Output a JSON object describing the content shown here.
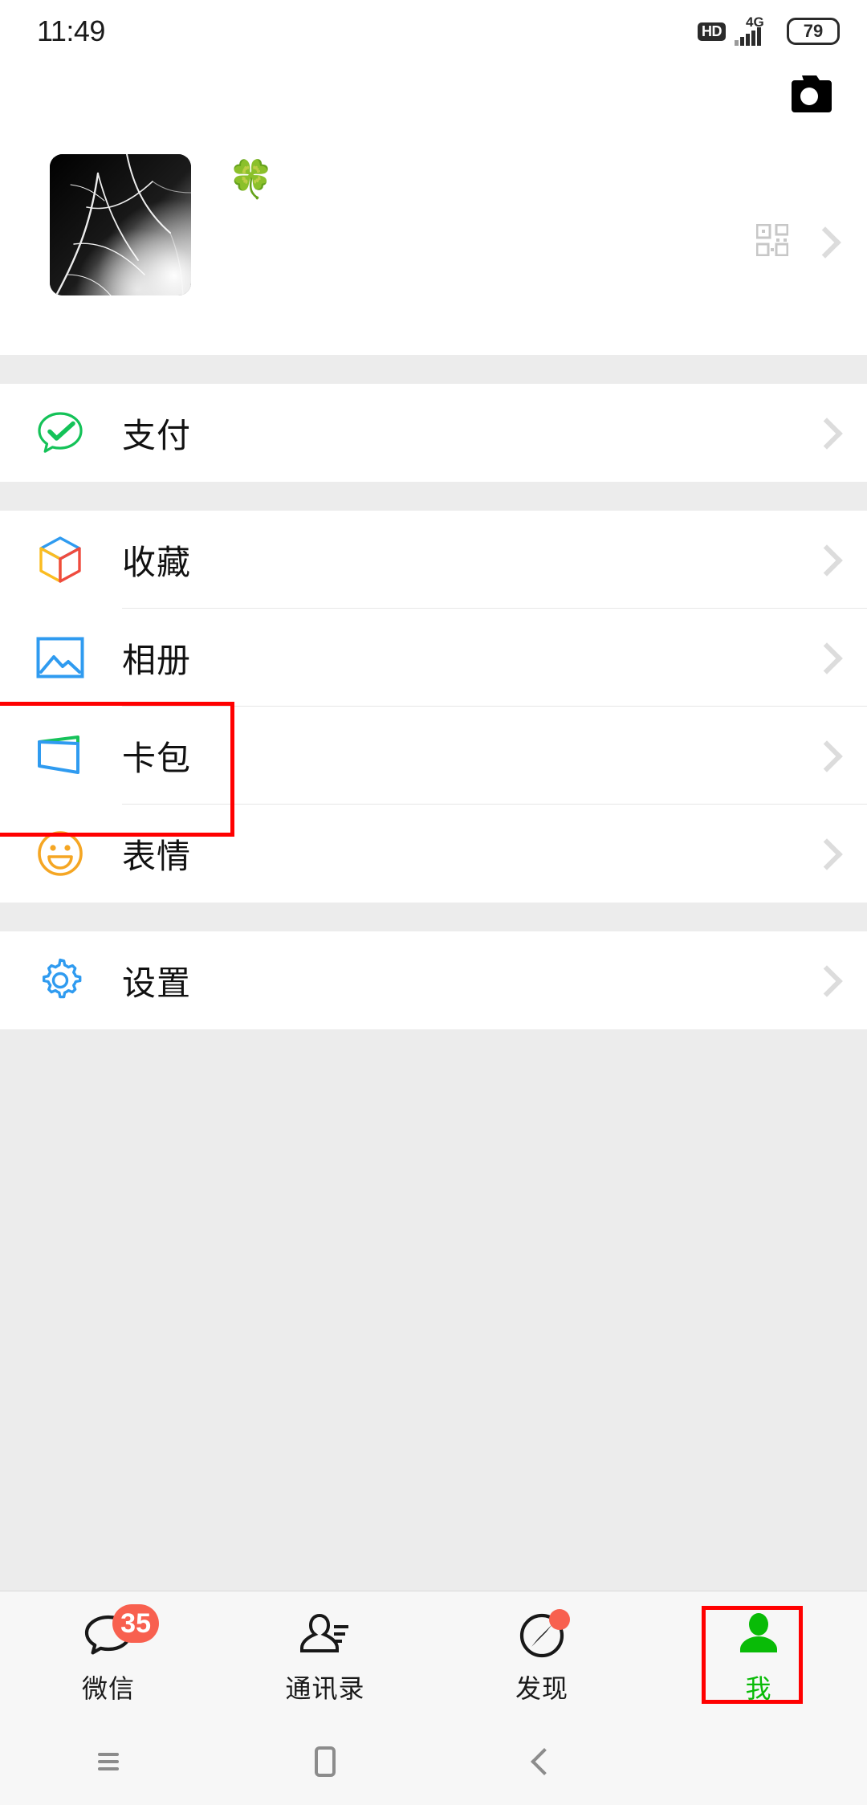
{
  "status_bar": {
    "time": "11:49",
    "hd_label": "HD",
    "network_label": "4G",
    "battery_level": "79"
  },
  "header": {
    "camera_icon": "camera-icon"
  },
  "profile": {
    "nickname": "🍀",
    "avatar_alt": "dark tree branches photo",
    "qr_icon": "qr-code-icon",
    "chevron": "chevron-right-icon"
  },
  "sections": [
    {
      "rows": [
        {
          "label": "支付",
          "icon": "wechat-pay-icon"
        }
      ]
    },
    {
      "rows": [
        {
          "label": "收藏",
          "icon": "favorites-cube-icon"
        },
        {
          "label": "相册",
          "icon": "album-photo-icon"
        },
        {
          "label": "卡包",
          "icon": "cards-wallet-icon"
        },
        {
          "label": "表情",
          "icon": "sticker-smiley-icon"
        }
      ]
    },
    {
      "rows": [
        {
          "label": "设置",
          "icon": "settings-gear-icon"
        }
      ]
    }
  ],
  "tabbar": {
    "items": [
      {
        "label": "微信",
        "icon": "chat-bubble-icon",
        "badge": "35",
        "active": false
      },
      {
        "label": "通讯录",
        "icon": "contacts-icon",
        "badge": "",
        "active": false
      },
      {
        "label": "发现",
        "icon": "compass-icon",
        "badge": "dot",
        "active": false
      },
      {
        "label": "我",
        "icon": "person-icon",
        "badge": "",
        "active": true
      }
    ]
  },
  "navbar": {
    "recents": "recents-icon",
    "home": "home-icon",
    "back": "back-icon"
  },
  "colors": {
    "accent_green": "#09bb07",
    "badge_red": "#f8604f",
    "annotation_red": "#ff0000",
    "page_bg": "#ececec",
    "card_bg": "#ffffff"
  },
  "annotations": [
    {
      "name": "album-row-highlight"
    },
    {
      "name": "me-tab-highlight"
    }
  ]
}
